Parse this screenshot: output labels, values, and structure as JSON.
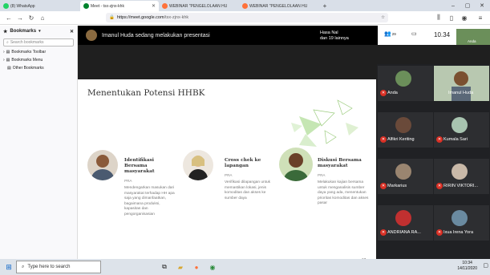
{
  "browser": {
    "tabs": [
      {
        "label": "(8) WhatsApp",
        "color": "#25d366"
      },
      {
        "label": "Meet - tsx-zjnx-khk",
        "color": "#00832d"
      },
      {
        "label": "WEBINAR \"PENGELOLAAN HU",
        "color": "#ff7139"
      },
      {
        "label": "WEBINAR \"PENGELOLAAN HU",
        "color": "#ff7139"
      }
    ],
    "new_tab": "+",
    "url_host": "https://meet.google.com",
    "url_path": "/tsx-zjnx-khk"
  },
  "sidebar": {
    "title": "Bookmarks",
    "search_placeholder": "Search bookmarks",
    "items": [
      "Bookmarks Toolbar",
      "Bookmarks Menu",
      "Other Bookmarks"
    ]
  },
  "meet": {
    "presenting": "Imanul Huda sedang melakukan presentasi",
    "participants_line1": "Hasa Nal",
    "participants_line2": "dan 19 lainnya",
    "people_count": "29",
    "time": "10.34",
    "self_label": "Anda"
  },
  "slide": {
    "title": "Menentukan Potensi HHBK",
    "columns": [
      {
        "title": "Identifikasi Bersama masyarakat",
        "tag": "PRA",
        "desc": "Mendengarkan masukan dari masyarakat terhadap HH apa saja yang dimanfaatkan, bagaimana produksi, kapasitas dan pengorganisasian"
      },
      {
        "title": "Cross chek ke lapangan",
        "tag": "PRA",
        "desc": "Verifikasi dilapangan untuk memastikan lokasi, jenis komoditas dan akses ke sumber daya"
      },
      {
        "title": "Diskusi Bersama masyarakat",
        "tag": "PRA",
        "desc": "Melakukan kajian bersama untuk menganalisis sumber daya yang ada, menentukan prioritas komoditas dan akses pasar"
      }
    ],
    "footer": "Your Logo or Name Here",
    "page": "17"
  },
  "participants": [
    {
      "name": "Anda",
      "color": "#6b8f5a"
    },
    {
      "name": "Imanul Huda",
      "color": "#8a6a40"
    },
    {
      "name": "Alfikri Keriting",
      "color": "#6a4a3a"
    },
    {
      "name": "Kumala Sari",
      "color": "#a8c4b0"
    },
    {
      "name": "Markarius",
      "color": "#9a8570"
    },
    {
      "name": "RIRIN VIKTORI...",
      "color": "#c9b9a8"
    },
    {
      "name": "ANDRIANA RA...",
      "color": "#c03030"
    },
    {
      "name": "Ixua Irena Yora",
      "color": "#6a8aa0"
    }
  ],
  "taskbar": {
    "search_placeholder": "Type here to search",
    "time": "10:34",
    "date": "14/11/2020"
  }
}
